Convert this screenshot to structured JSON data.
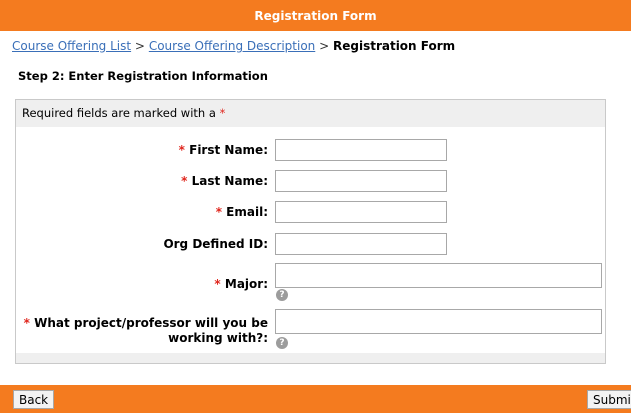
{
  "header": {
    "title": "Registration Form"
  },
  "breadcrumb": {
    "items": [
      "Course Offering List",
      "Course Offering Description"
    ],
    "separator": ">",
    "current": "Registration Form"
  },
  "step_title": "Step 2: Enter Registration Information",
  "form": {
    "required_note": "Required fields are marked with a",
    "required_marker": "*",
    "fields": [
      {
        "label": "First Name:",
        "required": true,
        "value": ""
      },
      {
        "label": "Last Name:",
        "required": true,
        "value": ""
      },
      {
        "label": "Email:",
        "required": true,
        "value": ""
      },
      {
        "label": "Org Defined ID:",
        "required": false,
        "value": ""
      },
      {
        "label": "Major:",
        "required": true,
        "value": "",
        "help": "?"
      },
      {
        "label_line1": "What project/professor will you be",
        "label_line2": "working with?:",
        "required": true,
        "value": "",
        "help": "?"
      }
    ]
  },
  "buttons": {
    "back": "Back",
    "submit": "Submit"
  },
  "colors": {
    "accent": "#f47b1f",
    "link": "#3a6fb8",
    "required": "#e0261d"
  }
}
